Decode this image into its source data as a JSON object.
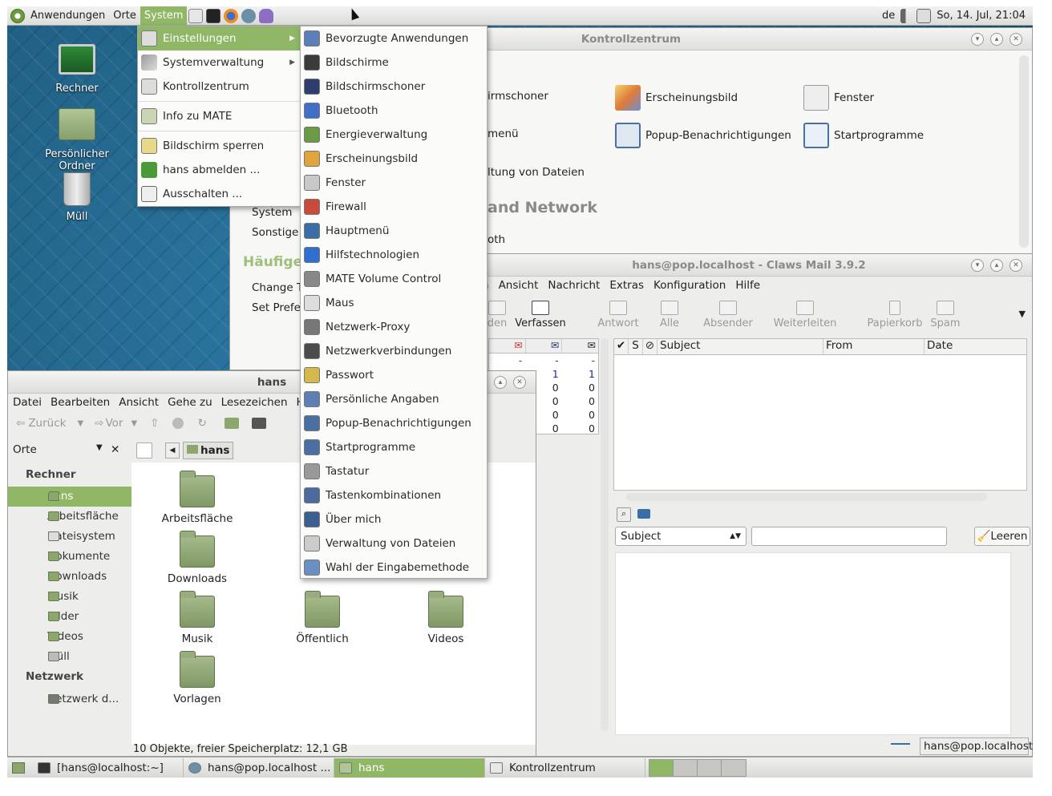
{
  "top_panel": {
    "menus": [
      "Anwendungen",
      "Orte",
      "System"
    ],
    "keyboard_layout": "de",
    "clock": "So, 14. Jul, 21:04"
  },
  "desktop_icons": [
    "Rechner",
    "Persönlicher Ordner",
    "Müll"
  ],
  "system_menu": {
    "items": [
      "Einstellungen",
      "Systemverwaltung",
      "Kontrollzentrum",
      "Info zu MATE",
      "Bildschirm sperren",
      "hans abmelden ...",
      "Ausschalten ..."
    ]
  },
  "einstellungen_submenu": {
    "items": [
      "Bevorzugte Anwendungen",
      "Bildschirme",
      "Bildschirmschoner",
      "Bluetooth",
      "Energieverwaltung",
      "Erscheinungsbild",
      "Fenster",
      "Firewall",
      "Hauptmenü",
      "Hilfstechnologien",
      "MATE Volume Control",
      "Maus",
      "Netzwerk-Proxy",
      "Netzwerkverbindungen",
      "Passwort",
      "Persönliche Angaben",
      "Popup-Benachrichtigungen",
      "Startprogramme",
      "Tastatur",
      "Tastenkombinationen",
      "Über mich",
      "Verwaltung von Dateien",
      "Wahl der Eingabemethode"
    ]
  },
  "control_center": {
    "title": "Kontrollzentrum",
    "items": [
      "irmschoner",
      "Erscheinungsbild",
      "Fenster",
      "menü",
      "Popup-Benachrichtigungen",
      "Startprogramme",
      "ltung von Dateien",
      "oth"
    ],
    "section_heading": "and Network",
    "sidebar": [
      "System",
      "Sonstige"
    ],
    "sidebar_heading": "Häufige",
    "sidebar_tasks": [
      "Change T",
      "Set Prefe"
    ]
  },
  "claws_mail": {
    "title": "hans@pop.localhost - Claws Mail 3.9.2",
    "menu": [
      "n",
      "Ansicht",
      "Nachricht",
      "Extras",
      "Konfiguration",
      "Hilfe"
    ],
    "toolbar": [
      "den",
      "Verfassen",
      "Antwort",
      "Alle",
      "Absender",
      "Weiterleiten",
      "Papierkorb",
      "Spam"
    ],
    "columns": [
      "S",
      "Subject",
      "From",
      "Date"
    ],
    "folder_counts": [
      [
        "-",
        "-",
        "-"
      ],
      [
        "",
        "1",
        "1"
      ],
      [
        "",
        "0",
        "0"
      ],
      [
        "",
        "0",
        "0"
      ],
      [
        "",
        "0",
        "0"
      ],
      [
        "",
        "0",
        "0"
      ]
    ],
    "search_field": "Subject",
    "clear_button": "Leeren",
    "account": "hans@pop.localhost"
  },
  "file_manager": {
    "title": "hans",
    "menu": [
      "Datei",
      "Bearbeiten",
      "Ansicht",
      "Gehe zu",
      "Lesezeichen",
      "Hil"
    ],
    "back": "Zurück",
    "forward": "Vor",
    "places_label": "Orte",
    "path": "hans",
    "sidebar_heading_computer": "Rechner",
    "sidebar_items": [
      "hans",
      "Arbeitsfläche",
      "Dateisystem",
      "Dokumente",
      "Downloads",
      "Musik",
      "Bilder",
      "Videos",
      "Müll"
    ],
    "sidebar_heading_network": "Netzwerk",
    "network_items": [
      "Netzwerk d..."
    ],
    "folders": [
      "Arbeitsfläche",
      "Downloads",
      "Musik",
      "Öffentlich",
      "Videos",
      "Vorlagen"
    ],
    "status": "10 Objekte, freier Speicherplatz: 12,1 GB"
  },
  "taskbar": {
    "tasks": [
      "[hans@localhost:~]",
      "hans@pop.localhost ...",
      "hans",
      "Kontrollzentrum"
    ]
  },
  "colors": {
    "accent": "#8fb765",
    "desktop": "#1f5d80"
  }
}
